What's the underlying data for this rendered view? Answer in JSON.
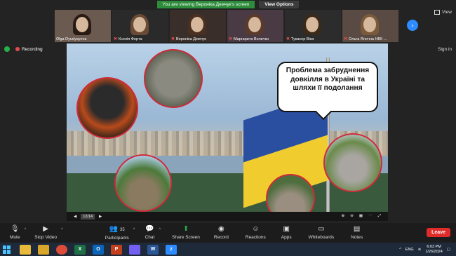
{
  "banner": {
    "text": "You are viewing Вероніка Демчук's screen",
    "view_options": "View Options"
  },
  "view_button": {
    "label": "View"
  },
  "participants": [
    {
      "name": "Olga Dyudyayeva",
      "muted": false,
      "bg": "#6a5a50"
    },
    {
      "name": "Ксенія Ферта",
      "muted": true,
      "bg": "#2a2a2a"
    },
    {
      "name": "Вероніка Демчук",
      "muted": true,
      "bg": "#3a2e2a"
    },
    {
      "name": "Маргарита Величко",
      "muted": true,
      "bg": "#4a3a44"
    },
    {
      "name": "Тукасер Віка",
      "muted": true,
      "bg": "#2c2c2c"
    },
    {
      "name": "Ольга Ялочна НВК ...",
      "muted": true,
      "bg": "#5a4a44"
    }
  ],
  "status": {
    "recording": "Recording",
    "sign_in": "Sign in"
  },
  "slide": {
    "title": "Проблема забруднення довкілля в Україні та шляхи її подолання",
    "page_indicator": "12/14"
  },
  "toolbar": {
    "mute": "Mute",
    "stop_video": "Stop Video",
    "participants": "Participants",
    "participants_count": "35",
    "chat": "Chat",
    "share_screen": "Share Screen",
    "record": "Record",
    "reactions": "Reactions",
    "apps": "Apps",
    "whiteboards": "Whiteboards",
    "notes": "Notes",
    "leave": "Leave"
  },
  "taskbar": {
    "language": "ENG",
    "time": "6:03 PM",
    "date": "1/26/2024"
  },
  "colors": {
    "accent": "#2d8cff",
    "share_green": "#27b04a",
    "leave_red": "#e02b2b",
    "banner_green": "#2c8c3a"
  }
}
